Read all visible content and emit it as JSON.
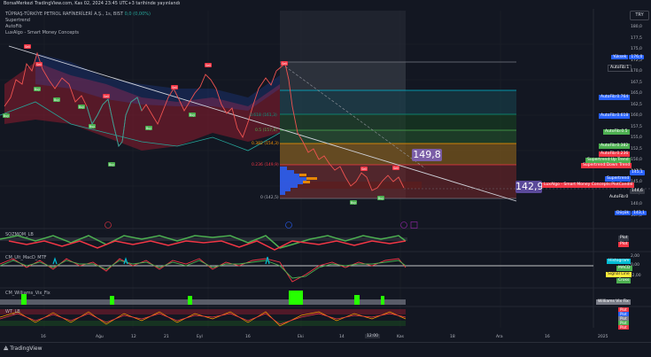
{
  "header": {
    "text": "BorsaMerkezi TradingView.com, Kas 02, 2024 23:45 UTC+3 tarihinde yayınlandı"
  },
  "indicators": {
    "symbol": "TÜPRAŞ-TÜRKİYE PETROL RAFİNERİLERİ A.Ş., 1s, BIST",
    "change": "0,0 (0,00%)",
    "items": [
      "Supertrend",
      "AutoFib",
      "LuxAlgo - Smart Money Concepts"
    ]
  },
  "currency": "TRY",
  "price_axis": {
    "ticks": [
      "180,0",
      "177,5",
      "175,0",
      "172,5",
      "170,0",
      "167,5",
      "165,0",
      "162,5",
      "160,0",
      "157,5",
      "155,0",
      "152,5",
      "150,0",
      "147,5",
      "145,0",
      "142,5",
      "140,0",
      "137,5"
    ],
    "tags": [
      {
        "label": "Yüksek",
        "value": "176,0",
        "color": "#2962ff"
      },
      {
        "label": "AutoFib:1",
        "value": "",
        "color": "#131722"
      },
      {
        "label": "AutoFib:0.764",
        "value": "",
        "color": "#2962ff"
      },
      {
        "label": "AutoFib:0.618",
        "value": "",
        "color": "#2962ff"
      },
      {
        "label": "AutoFib:0.5",
        "value": "",
        "color": "#4caf50"
      },
      {
        "label": "AutoFib:0.382",
        "value": "",
        "color": "#4caf50"
      },
      {
        "label": "AutoFib:0.236",
        "value": "",
        "color": "#f23645"
      },
      {
        "label": "Supertrend:Up Trend",
        "value": "",
        "color": "#4caf50"
      },
      {
        "label": "Supertrend:Down Trend",
        "value": "",
        "color": "#f23645"
      },
      {
        "label": "",
        "value": "145,1",
        "color": "#2962ff"
      },
      {
        "label": "Supertrend",
        "value": "",
        "color": "#2962ff"
      },
      {
        "label": "LuxAlgo - Smart Money Concepts:PlotCandle",
        "value": "",
        "color": "#f23645"
      },
      {
        "label": "",
        "value": "144,6",
        "color": "#363a45"
      },
      {
        "label": "AutoFib:0",
        "value": "",
        "color": "#131722"
      },
      {
        "label": "Düşük",
        "value": "143,1",
        "color": "#2962ff"
      }
    ]
  },
  "fib_levels": [
    "1 (173,2)",
    "0.786 (166,1)",
    "0.618 (161,3)",
    "0.5 (157,8)",
    "0.382 (154,3)",
    "0.236 (149,9)",
    "0 (142,5)"
  ],
  "big_labels": {
    "upper": "149,8",
    "lower": "142,9"
  },
  "time_axis": [
    "16",
    "Ağu",
    "12",
    "21",
    "Eyl",
    "16",
    "Eki",
    "14",
    "12:00",
    "Kas",
    "18",
    "Ara",
    "16",
    "2025"
  ],
  "time_axis_selected": "12:00",
  "markers": {
    "sell": "Sell",
    "buy": "Buy"
  },
  "panes": {
    "squeeze": {
      "title": "SQZMOM_LB",
      "tags": [
        {
          "label": "Plot",
          "color": "#363a45"
        },
        {
          "label": "Plot",
          "color": "#f23645"
        }
      ]
    },
    "macd": {
      "title": "CM_Ult_MacD_MTF",
      "ticks": [
        "2,00",
        "0,00",
        "-2,00"
      ],
      "tags": [
        {
          "label": "Histogram",
          "color": "#00bcd4"
        },
        {
          "label": "MACD",
          "color": "#4caf50"
        },
        {
          "label": "Signal Line",
          "color": "#ffeb3b"
        },
        {
          "label": "Cross",
          "color": "#4caf50"
        }
      ]
    },
    "williams": {
      "title": "CM_Williams_Vix_Fix",
      "tags": [
        {
          "label": "Williams Vix Fix",
          "color": "#787b86"
        }
      ]
    },
    "wt": {
      "title": "WT_LB",
      "tags": [
        {
          "label": "Plot",
          "color": "#f23645"
        },
        {
          "label": "Plot",
          "color": "#2962ff"
        },
        {
          "label": "Plot",
          "color": "#787b86"
        },
        {
          "label": "Plot",
          "color": "#4caf50"
        },
        {
          "label": "Plot",
          "color": "#f23645"
        }
      ]
    }
  },
  "footer": {
    "logo": "TradingView"
  },
  "colors": {
    "bg": "#131722",
    "up": "#26a69a",
    "down": "#ef5350",
    "accent": "#2962ff",
    "fib_green": "#4caf50"
  }
}
